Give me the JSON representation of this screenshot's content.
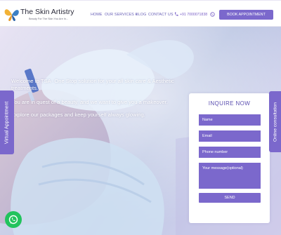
{
  "brand": {
    "name": "The Skin Artistry",
    "tagline": "Beauty For The Skin You Are In..."
  },
  "nav": {
    "items": [
      "HOME",
      "OUR SERVICES",
      "BLOG",
      "CONTACT US"
    ]
  },
  "contact": {
    "phone": "+91 7000071838"
  },
  "header": {
    "book_button": "BOOK APPOINTMENT"
  },
  "hero": {
    "line1": "Welcome to TSA- One Stop solution for your all skin care & Aesthetic treatments.",
    "line2": "You are in quest of a beauty, and we want to give you a makeover.",
    "line3": "Explore our packages and keep yourself always glowing."
  },
  "side_tabs": {
    "left": "Virtual Appointment",
    "right": "Online consultation"
  },
  "form": {
    "title": "INQUIRE NOW",
    "name_placeholder": "Name",
    "email_placeholder": "Email",
    "phone_placeholder": "Phone number",
    "message_placeholder": "Your message(optional)",
    "send_label": "SEND"
  },
  "colors": {
    "accent": "#7b68cc",
    "title": "#5b4fb0",
    "whatsapp": "#22c35e"
  }
}
